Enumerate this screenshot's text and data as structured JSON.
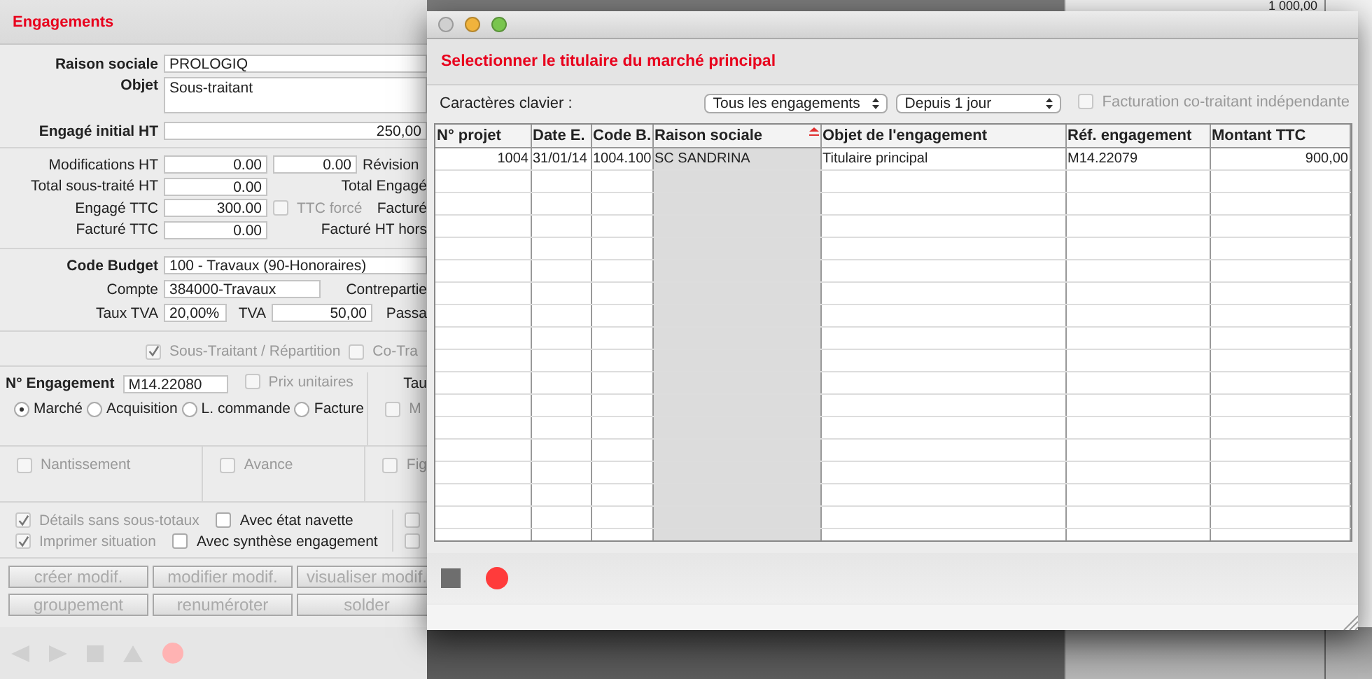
{
  "main_window": {
    "title": "Engagements",
    "raison_sociale": {
      "label": "Raison sociale",
      "value": "PROLOGIQ"
    },
    "objet": {
      "label": "Objet",
      "value": "Sous-traitant"
    },
    "engage_initial": {
      "label": "Engagé initial HT",
      "value": "250,00"
    },
    "amount_rows": [
      {
        "label": "Modifications HT",
        "value": "0.00",
        "extra_value": "0.00",
        "side_label": "Révision"
      },
      {
        "label": "Total sous-traité HT",
        "value": "0.00",
        "side_label": "Total Engagé"
      },
      {
        "label": "Engagé TTC",
        "value": "300.00",
        "checkbox": {
          "label": "TTC forcé",
          "checked": false,
          "disabled": true
        },
        "side_label": "Facturé"
      },
      {
        "label": "Facturé TTC",
        "value": "0.00",
        "side_label": "Facturé HT hors"
      }
    ],
    "budget": {
      "label": "Code Budget",
      "value": "100 - Travaux (90-Honoraires)"
    },
    "compte": {
      "label": "Compte",
      "value": "384000-Travaux",
      "side_label": "Contrepartie"
    },
    "tva": {
      "label": "Taux TVA",
      "value": "20,00%",
      "tva_label": "TVA",
      "tva_value": "50,00",
      "side_label": "Passa"
    },
    "repartition": [
      {
        "label": "Sous-Traitant / Répartition",
        "checked": true,
        "disabled": true
      },
      {
        "label": "Co-Tra",
        "checked": false,
        "disabled": true
      }
    ],
    "engagement": {
      "label": "N° Engagement",
      "value": "M14.22080",
      "prix": {
        "label": "Prix unitaires",
        "checked": false,
        "disabled": true
      },
      "side_label": "Tau",
      "radios": [
        {
          "label": "Marché",
          "selected": true
        },
        {
          "label": "Acquisition",
          "selected": false
        },
        {
          "label": "L. commande",
          "selected": false
        },
        {
          "label": "Facture",
          "selected": false
        }
      ],
      "side_checkbox": {
        "label": "M",
        "checked": false,
        "disabled": true
      }
    },
    "options": [
      {
        "label": "Nantissement",
        "checked": false,
        "disabled": true
      },
      {
        "label": "Avance",
        "checked": false,
        "disabled": true
      },
      {
        "label": "Fig",
        "checked": false,
        "disabled": true
      }
    ],
    "print_options": [
      {
        "items": [
          {
            "label": "Détails sans sous-totaux",
            "checked": true,
            "disabled": true
          },
          {
            "label": "Avec état navette",
            "checked": false,
            "disabled": false
          }
        ],
        "side": {
          "checked": false,
          "disabled": true
        }
      },
      {
        "items": [
          {
            "label": "Imprimer situation",
            "checked": true,
            "disabled": true
          },
          {
            "label": "Avec synthèse engagement",
            "checked": false,
            "disabled": false
          }
        ],
        "side": {
          "checked": false,
          "disabled": true
        }
      }
    ],
    "buttons": [
      [
        {
          "label": "créer modif.",
          "disabled": true
        },
        {
          "label": "modifier modif.",
          "disabled": true
        },
        {
          "label": "visualiser modif.",
          "disabled": true
        }
      ],
      [
        {
          "label": "groupement",
          "disabled": true
        },
        {
          "label": "renuméroter",
          "disabled": true
        },
        {
          "label": "solder",
          "disabled": true
        }
      ]
    ]
  },
  "background_window": {
    "amount": "1 000,00"
  },
  "dialog": {
    "heading": "Selectionner le titulaire du marché principal",
    "keyboard_label": "Caractères clavier :",
    "filters": [
      {
        "value": "Tous les engagements"
      },
      {
        "value": "Depuis 1 jour"
      }
    ],
    "independent": {
      "label": "Facturation co-traitant indépendante",
      "checked": false,
      "disabled": true
    },
    "table": {
      "columns": [
        {
          "label": "N° projet",
          "sorted": false
        },
        {
          "label": "Date E.",
          "sorted": false
        },
        {
          "label": "Code B.",
          "sorted": false
        },
        {
          "label": "Raison sociale",
          "sorted": true
        },
        {
          "label": "Objet de l'engagement",
          "sorted": false
        },
        {
          "label": "Réf. engagement",
          "sorted": false
        },
        {
          "label": "Montant TTC",
          "sorted": false
        }
      ],
      "rows": [
        {
          "cells": [
            "1004",
            "31/01/14",
            "1004.100",
            "SC SANDRINA",
            "Titulaire principal",
            "M14.22079",
            "900,00"
          ],
          "selected": false
        }
      ]
    }
  }
}
